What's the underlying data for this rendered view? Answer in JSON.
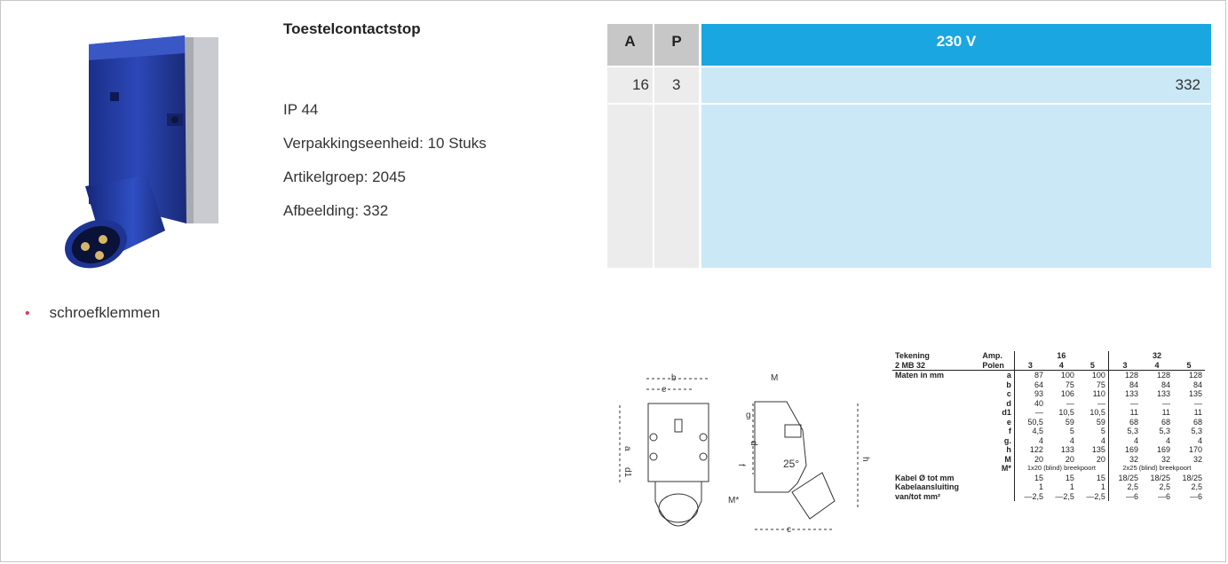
{
  "product": {
    "title": "Toestelcontactstop",
    "specs": [
      "IP 44",
      "Verpakkingseenheid: 10 Stuks",
      "Artikelgroep: 2045",
      "Afbeelding: 332"
    ],
    "features": [
      "schroefklemmen"
    ]
  },
  "price_table": {
    "header_a": "A",
    "header_p": "P",
    "header_voltage": "230 V",
    "rows": [
      {
        "a": "16",
        "p": "3",
        "value": "332"
      }
    ]
  },
  "drawing_labels": {
    "b": "b",
    "e": "e",
    "a": "a",
    "d1": "d1",
    "d": "d",
    "f": "f",
    "g": "g",
    "h": "h",
    "M": "M",
    "Mstar": "M*",
    "c": "c",
    "angle": "25°"
  },
  "dimensions_table": {
    "tekening_label": "Tekening",
    "model": "2 MB 32",
    "amp_label": "Amp.",
    "polen_label": "Polen",
    "amp_groups": [
      "16",
      "32"
    ],
    "polen": [
      "3",
      "4",
      "5",
      "3",
      "4",
      "5"
    ],
    "maten_label": "Maten in mm",
    "rows": [
      {
        "k": "a",
        "v": [
          "87",
          "100",
          "100",
          "128",
          "128",
          "128"
        ]
      },
      {
        "k": "b",
        "v": [
          "64",
          "75",
          "75",
          "84",
          "84",
          "84"
        ]
      },
      {
        "k": "c",
        "v": [
          "93",
          "106",
          "110",
          "133",
          "133",
          "135"
        ]
      },
      {
        "k": "d",
        "v": [
          "40",
          "—",
          "—",
          "—",
          "—",
          "—"
        ]
      },
      {
        "k": "d1",
        "v": [
          "—",
          "10,5",
          "10,5",
          "11",
          "11",
          "11"
        ]
      },
      {
        "k": "e",
        "v": [
          "50,5",
          "59",
          "59",
          "68",
          "68",
          "68"
        ]
      },
      {
        "k": "f",
        "v": [
          "4,5",
          "5",
          "5",
          "5,3",
          "5,3",
          "5,3"
        ]
      },
      {
        "k": "g.",
        "v": [
          "4",
          "4",
          "4",
          "4",
          "4",
          "4"
        ]
      },
      {
        "k": "h",
        "v": [
          "122",
          "133",
          "135",
          "169",
          "169",
          "170"
        ]
      },
      {
        "k": "M",
        "v": [
          "20",
          "20",
          "20",
          "32",
          "32",
          "32"
        ]
      }
    ],
    "mstar_label": "M*",
    "mstar_16": "1x20 (blind) breekpoort",
    "mstar_32": "2x25 (blind) breekpoort",
    "kabel_label": "Kabel Ø tot mm",
    "kabel": [
      "15",
      "15",
      "15",
      "18/25",
      "18/25",
      "18/25"
    ],
    "aansluiting_label": "Kabelaansluiting",
    "vantot_label": "van/tot mm²",
    "aansluiting_from": [
      "1",
      "1",
      "1",
      "2,5",
      "2,5",
      "2,5"
    ],
    "aansluiting_to": [
      "—2,5",
      "—2,5",
      "—2,5",
      "—6",
      "—6",
      "—6"
    ]
  }
}
